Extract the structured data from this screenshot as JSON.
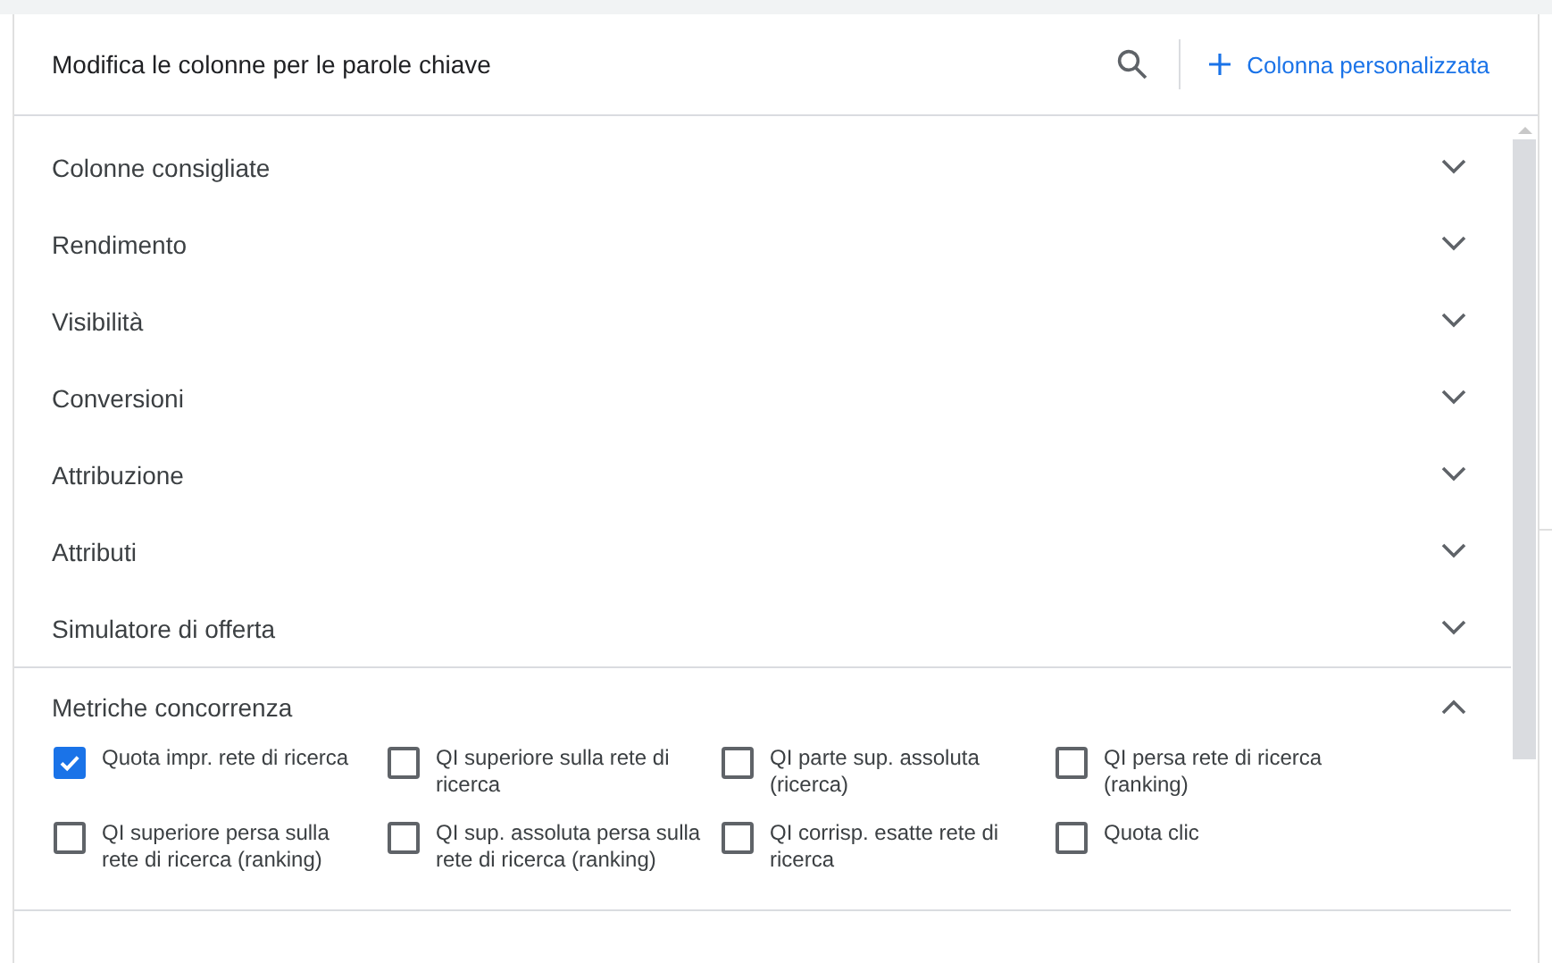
{
  "dialog": {
    "title": "Modifica le colonne per le parole chiave",
    "add_button": "Colonna personalizzata"
  },
  "sections": [
    {
      "title": "Colonne consigliate",
      "expanded": false
    },
    {
      "title": "Rendimento",
      "expanded": false
    },
    {
      "title": "Visibilità",
      "expanded": false
    },
    {
      "title": "Conversioni",
      "expanded": false
    },
    {
      "title": "Attribuzione",
      "expanded": false
    },
    {
      "title": "Attributi",
      "expanded": false
    },
    {
      "title": "Simulatore di offerta",
      "expanded": false
    },
    {
      "title": "Metriche concorrenza",
      "expanded": true,
      "options": [
        {
          "label": "Quota impr. rete di ricerca",
          "checked": true
        },
        {
          "label": "QI superiore sulla rete di ricerca",
          "checked": false
        },
        {
          "label": "QI parte sup. assoluta (ricerca)",
          "checked": false
        },
        {
          "label": "QI persa rete di ricerca (ranking)",
          "checked": false
        },
        {
          "label": "QI superiore persa sulla rete di ricerca (ranking)",
          "checked": false
        },
        {
          "label": "QI sup. assoluta persa sulla rete di ricerca (ranking)",
          "checked": false
        },
        {
          "label": "QI corrisp. esatte rete di ricerca",
          "checked": false
        },
        {
          "label": "Quota clic",
          "checked": false
        }
      ]
    }
  ]
}
